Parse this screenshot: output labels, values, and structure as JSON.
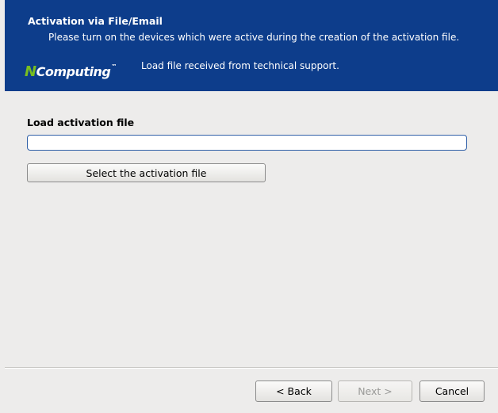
{
  "header": {
    "title": "Activation via File/Email",
    "description": "Please turn on the devices which were active during the creation of the activation file.",
    "logo_mark": "N",
    "logo_text": "Computing",
    "logo_tm": "™",
    "subtitle": "Load file received from technical support."
  },
  "form": {
    "section_label": "Load activation file",
    "file_path_value": "",
    "select_button_label": "Select the activation file"
  },
  "footer": {
    "back_label": "< Back",
    "next_label": "Next >",
    "next_enabled": false,
    "cancel_label": "Cancel"
  },
  "colors": {
    "header_bg": "#0d3d8b",
    "logo_accent": "#78be20",
    "window_bg": "#edeceb"
  }
}
